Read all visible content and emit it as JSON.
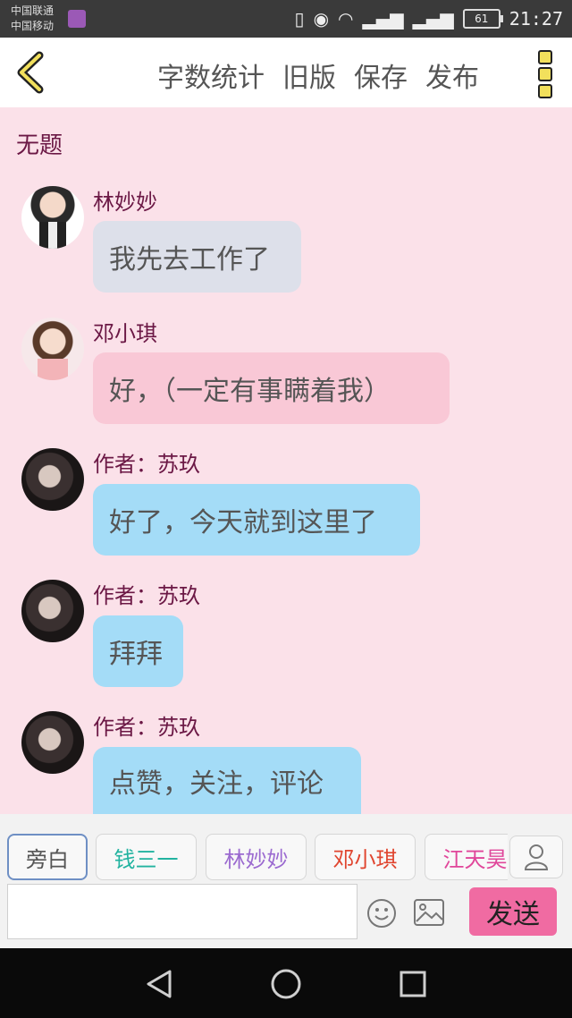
{
  "status_bar": {
    "carriers": [
      "中国联通",
      "中国移动"
    ],
    "battery": "61",
    "time": "21:27"
  },
  "toolbar": {
    "actions": [
      "字数统计",
      "旧版",
      "保存",
      "发布"
    ]
  },
  "document": {
    "title": "无题"
  },
  "messages": [
    {
      "name": "林妙妙",
      "text": "我先去工作了",
      "style": "grey"
    },
    {
      "name": "邓小琪",
      "text": "好，（一定有事瞒着我）",
      "style": "pink"
    },
    {
      "name": "作者：苏玖",
      "text": "好了，今天就到这里了",
      "style": "blue"
    },
    {
      "name": "作者：苏玖",
      "text": "拜拜",
      "style": "blue"
    },
    {
      "name": "作者：苏玖",
      "text": "点赞，关注，评论",
      "style": "blue"
    }
  ],
  "characters": [
    {
      "label": "旁白",
      "color": "#555555",
      "selected": true
    },
    {
      "label": "钱三一",
      "color": "#22b3a0",
      "selected": false
    },
    {
      "label": "林妙妙",
      "color": "#9b6ad0",
      "selected": false
    },
    {
      "label": "邓小琪",
      "color": "#e0452f",
      "selected": false
    },
    {
      "label": "江天昊",
      "color": "#e0469a",
      "selected": false
    }
  ],
  "composer": {
    "input_value": "",
    "send_label": "发送"
  },
  "colors": {
    "background": "#fbe1e9",
    "name_text": "#6b1845",
    "send_button": "#f06ba2"
  }
}
